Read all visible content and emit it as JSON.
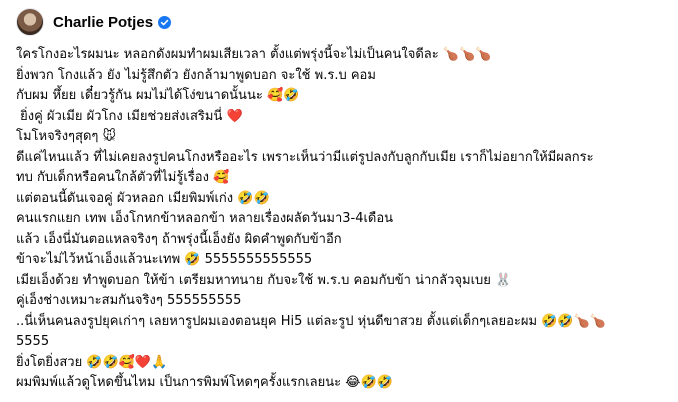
{
  "post": {
    "author": "Charlie Potjes",
    "verified_icon": "verified-badge-icon",
    "avatar_icon": "avatar",
    "lines": [
      "ใครโกงอะไรผมนะ หลอกดังผมทำผมเสียเวลา ตั้งแต่พรุ่งนี้จะไม่เป็นคนใจดีละ 🍗🍗🍗",
      "ยิ่งพวก โกงแล้ว ยัง ไม่รู้สึกตัว ยังกล้ามาพูดบอก จะใช้ พ.ร.บ คอม",
      "กับผม หึ้ยย เดี๋ยวรู้กัน ผมไม่ได้โง่ขนาดนั้นนะ 🥰🤣",
      " ยิ่งคู่ ผัวเมีย ผัวโกง เมียช่วยส่งเสริมนี่ ❤️",
      "โมโหจริงๆสุดๆ 🐭",
      "ดีแค่ไหนแล้ว ที่ไม่เคยลงรูปคนโกงหรืออะไร เพราะเห็นว่ามีแต่รูปลงกับลูกกับเมีย เราก็ไม่อยากให้มีผลกระ",
      "ทบ กับเด็กหรือคนใกล้ตัวที่ไม่รู้เรื่อง 🥰",
      "แต่ตอนนี้ดันเจอคู่ ผัวหลอก เมียพิมพ์เก่ง 🤣🤣",
      "คนแรกแยก เทพ เอ็งโกหกข้าหลอกข้า หลายเรื่องผลัดวันมา3-4เดือน",
      "แล้ว เอ็งนี่มันตอแหลจริงๆ ถ้าพรุ่งนี้เอ็งยัง ผิดคำพูดกับข้าอีก",
      "ข้าจะไม่ไว้หน้าเอ็งแล้วนะเทพ 🤣 5555555555555",
      "เมียเอ็งด้วย ทำพูดบอก ให้ข้า เตรียมหาทนาย กับจะใช้ พ.ร.บ คอมกับข้า น่ากลัวจุมเบย 🐰",
      "คู่เอ็งช่างเหมาะสมกันจริงๆ 555555555",
      "..นี่เห็นคนลงรูปยุคเก่าๆ เลยหารูปผมเองตอนยุค Hi5 แต่ละรูป หุ่นดีขาสวย ตั้งแต่เด็กๆเลยอะผม 🤣🤣🍗🍗",
      "5555",
      "ยิ่งโตยิ่งสวย 🤣🤣🥰❤️🙏",
      "ผมพิมพ์แล้วดูโหดขึ้นไหม เป็นการพิมพ์โหดๆครั้งแรกเลยนะ 😂🤣🤣"
    ]
  }
}
